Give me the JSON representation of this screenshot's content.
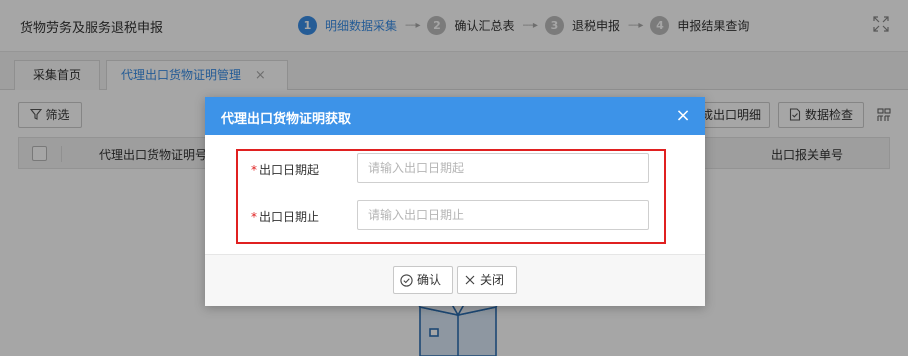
{
  "header": {
    "title": "货物劳务及服务退税申报",
    "steps": [
      {
        "num": "1",
        "label": "明细数据采集"
      },
      {
        "num": "2",
        "label": "确认汇总表"
      },
      {
        "num": "3",
        "label": "退税申报"
      },
      {
        "num": "4",
        "label": "申报结果查询"
      }
    ],
    "step_arrow": "----▸"
  },
  "tabs": [
    {
      "label": "采集首页"
    },
    {
      "label": "代理出口货物证明管理",
      "close": "×"
    }
  ],
  "toolbar": {
    "filter_label": "筛选",
    "generate_label": "成出口明细",
    "check_label": "数据检查"
  },
  "table": {
    "columns": [
      "代理出口货物证明号",
      "出口报关单号"
    ]
  },
  "dialog": {
    "title": "代理出口货物证明获取",
    "close": "×",
    "required_mark": "*",
    "fields": [
      {
        "label": "出口日期起",
        "placeholder": "请输入出口日期起",
        "value": ""
      },
      {
        "label": "出口日期止",
        "placeholder": "请输入出口日期止",
        "value": ""
      }
    ],
    "confirm_label": "确认",
    "cancel_label": "关闭"
  },
  "colors": {
    "accent": "#3a8ee6",
    "dialog_header": "#3d93e8",
    "highlight": "#e02020",
    "step_inactive": "#bdbdbd"
  },
  "icons": [
    "filter-icon",
    "check-doc-icon",
    "grid-icon",
    "expand-icon",
    "close-icon",
    "check-circle-icon",
    "x-icon",
    "empty-box-icon"
  ]
}
